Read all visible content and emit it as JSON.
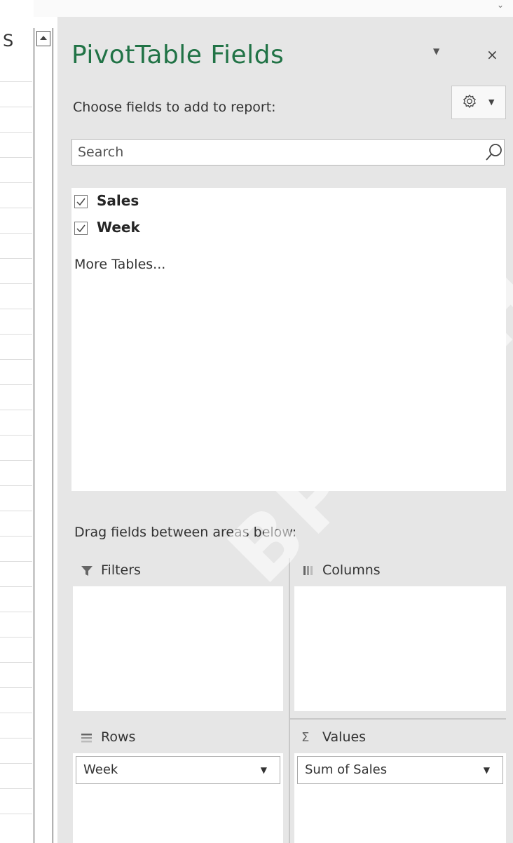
{
  "sheet": {
    "column_header_char": "S"
  },
  "pane": {
    "title": "PivotTable Fields",
    "choose_label": "Choose fields to add to report:",
    "search": {
      "placeholder": "Search",
      "value": ""
    },
    "fields": [
      {
        "label": "Sales",
        "checked": true
      },
      {
        "label": "Week",
        "checked": true
      }
    ],
    "more_tables": "More Tables...",
    "drag_label": "Drag fields between areas below:",
    "areas": {
      "filters": {
        "title": "Filters"
      },
      "columns": {
        "title": "Columns"
      },
      "rows": {
        "title": "Rows",
        "items": [
          "Week"
        ]
      },
      "values": {
        "title": "Values",
        "items": [
          "Sum of Sales"
        ]
      }
    }
  },
  "colors": {
    "title_green": "#217346",
    "pane_bg": "#e6e6e6"
  },
  "watermark": "BPSYCHO"
}
